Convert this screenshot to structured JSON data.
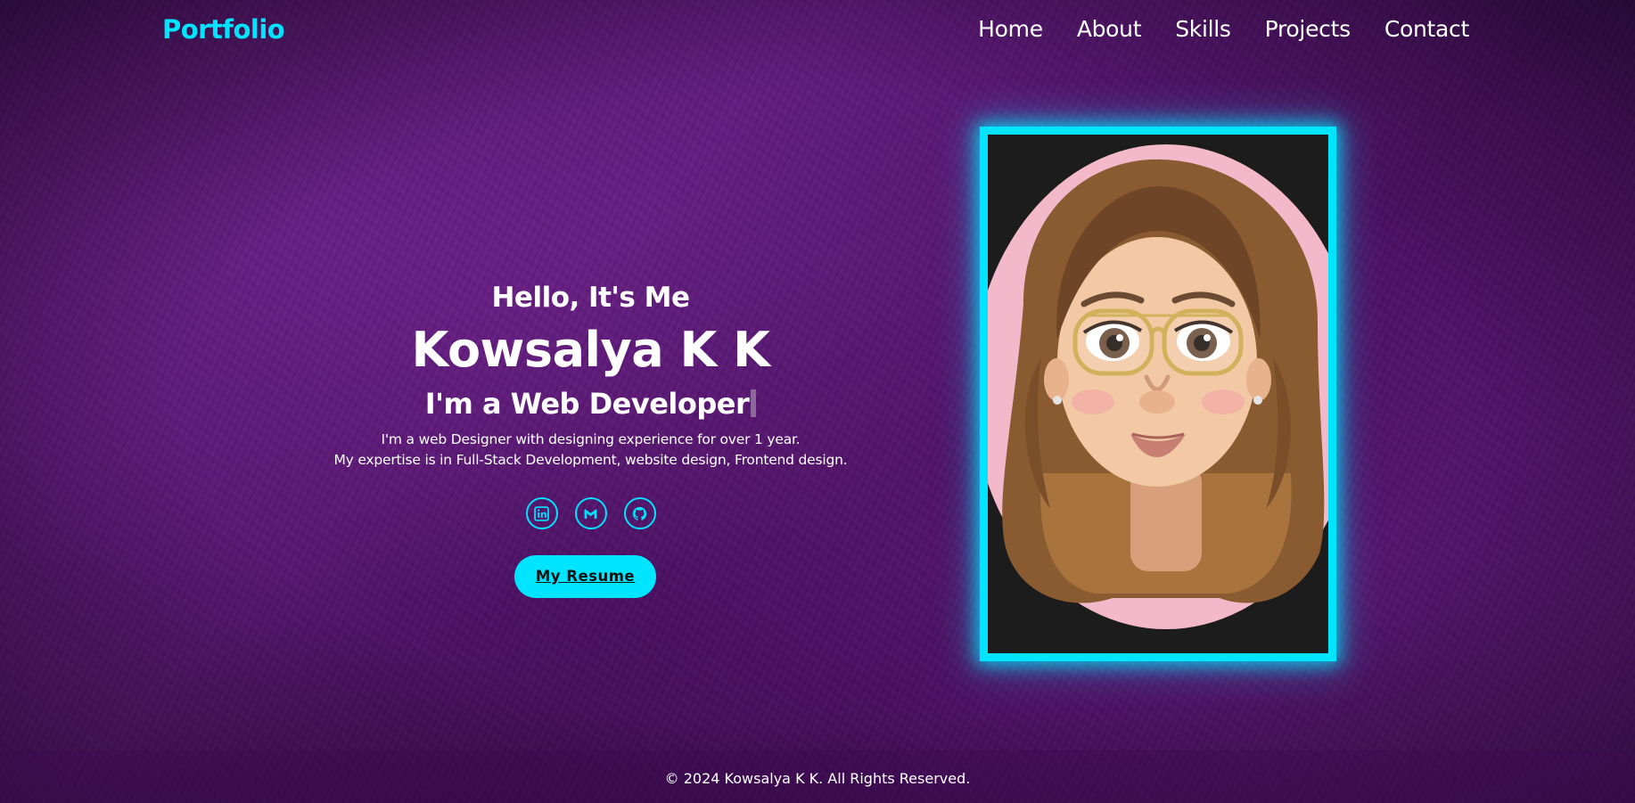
{
  "header": {
    "logo": "Portfolio",
    "nav": [
      "Home",
      "About",
      "Skills",
      "Projects",
      "Contact"
    ]
  },
  "hero": {
    "greeting": "Hello, It's Me",
    "name": "Kowsalya K K",
    "role": "I'm a Web Developer",
    "description_line1": "I'm a web Designer with designing experience for over 1 year.",
    "description_line2": "My expertise is in Full-Stack Development, website design, Frontend design.",
    "socials": [
      "linkedin-icon",
      "gmail-icon",
      "github-icon"
    ],
    "resume_label": "My Resume"
  },
  "footer": {
    "copyright": "© 2024 Kowsalya K K. All Rights Reserved."
  },
  "colors": {
    "accent": "#00e5ff",
    "background": "#4a0f63",
    "text": "#ffffff"
  }
}
